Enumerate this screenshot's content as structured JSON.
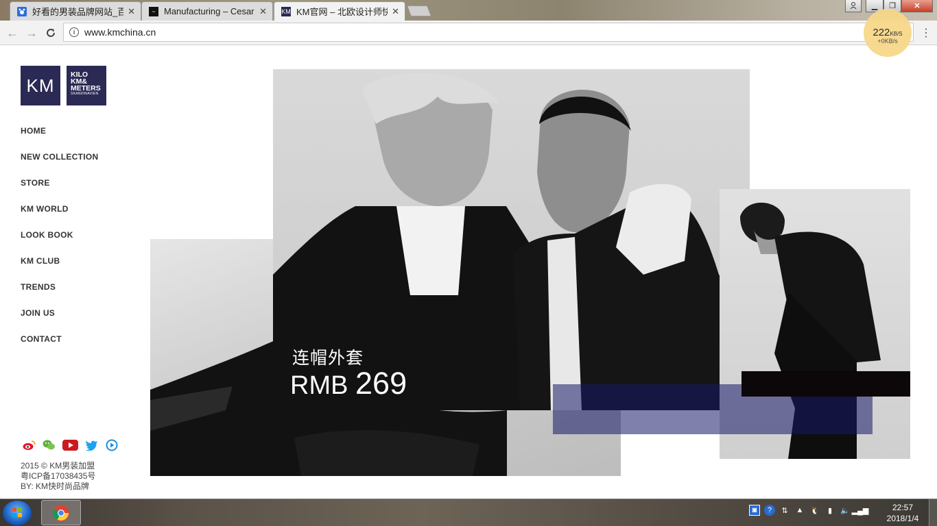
{
  "browser": {
    "tabs": [
      {
        "title": "好看的男装品牌网站_百度",
        "favicon": "baidu-paw-icon",
        "active": false
      },
      {
        "title": "Manufacturing – Cesar",
        "favicon": "cesar-logo-icon",
        "active": false
      },
      {
        "title": "KM官网 – 北欧设计师快",
        "favicon": "km-logo-icon",
        "active": true
      }
    ],
    "url": "www.kmchina.cn",
    "speed": {
      "value": "222",
      "unit": "KB/S",
      "upload": "+0KB/s"
    }
  },
  "site": {
    "logo_km": "KM",
    "logo_kilo": [
      "KILO",
      "KM&",
      "METERS",
      "SKANDINAVIEN"
    ],
    "nav": [
      "HOME",
      "NEW COLLECTION",
      "STORE",
      "KM WORLD",
      "LOOK BOOK",
      "KM CLUB",
      "TRENDS",
      "JOIN US",
      "CONTACT"
    ],
    "social_icons": [
      "weibo-icon",
      "wechat-icon",
      "youtube-icon",
      "twitter-icon",
      "youku-icon"
    ],
    "footer": [
      "2015 © KM男装加盟",
      "粤ICP备17038435号",
      "BY: KM快时尚品牌"
    ],
    "hero": {
      "caption": "连帽外套",
      "price_prefix": "RMB",
      "price_value": "269"
    },
    "colors": {
      "brand": "#2b2a55",
      "overlay_blue": "#17186a",
      "overlay_black": "#0c0709"
    }
  },
  "taskbar": {
    "time": "22:57",
    "date": "2018/1/4"
  }
}
